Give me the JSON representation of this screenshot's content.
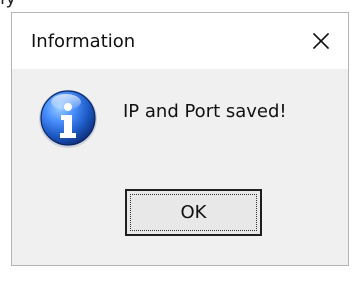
{
  "dialog": {
    "title": "Information",
    "message": "IP and Port saved!",
    "ok_label": "OK"
  },
  "icons": {
    "dialog_icon": "info-icon",
    "close_icon": "close-icon"
  },
  "colors": {
    "title_background": "#ffffff",
    "content_background": "#f0f0f0",
    "icon_blue": "#1e5bc6"
  }
}
